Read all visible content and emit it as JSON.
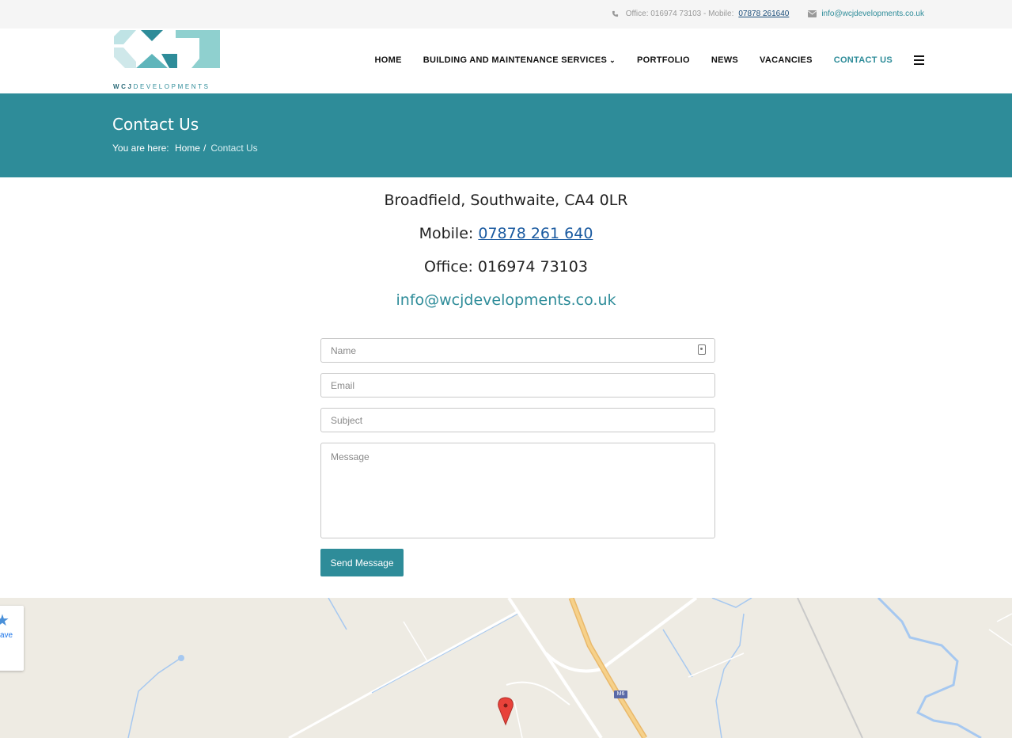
{
  "topbar": {
    "office_text": "Office: 016974 73103 - Mobile:",
    "mobile_link": "07878 261640",
    "email": "info@wcjdevelopments.co.uk"
  },
  "logo": {
    "brand_bold": "WCJ",
    "brand_rest": "DEVELOPMENTS"
  },
  "nav": {
    "items": [
      {
        "label": "HOME"
      },
      {
        "label": "BUILDING AND MAINTENANCE SERVICES"
      },
      {
        "label": "PORTFOLIO"
      },
      {
        "label": "NEWS"
      },
      {
        "label": "VACANCIES"
      },
      {
        "label": "CONTACT US"
      }
    ]
  },
  "page": {
    "title": "Contact Us",
    "breadcrumb_prefix": "You are here:",
    "breadcrumb_home": "Home",
    "breadcrumb_sep": "/",
    "breadcrumb_current": "Contact Us"
  },
  "contact": {
    "address": "Broadfield, Southwaite, CA4 0LR",
    "mobile_label": "Mobile:",
    "mobile_number": "07878 261 640",
    "office": "Office: 016974 73103",
    "email": "info@wcjdevelopments.co.uk"
  },
  "form": {
    "name_placeholder": "Name",
    "email_placeholder": "Email",
    "subject_placeholder": "Subject",
    "message_placeholder": "Message",
    "submit_label": "Send Message"
  },
  "map": {
    "save_label": "ave",
    "road_badge": "M6"
  },
  "colors": {
    "accent": "#2e8c99",
    "link": "#1a5aa0",
    "map_bg": "#eeebe3",
    "marker": "#e8423a"
  }
}
